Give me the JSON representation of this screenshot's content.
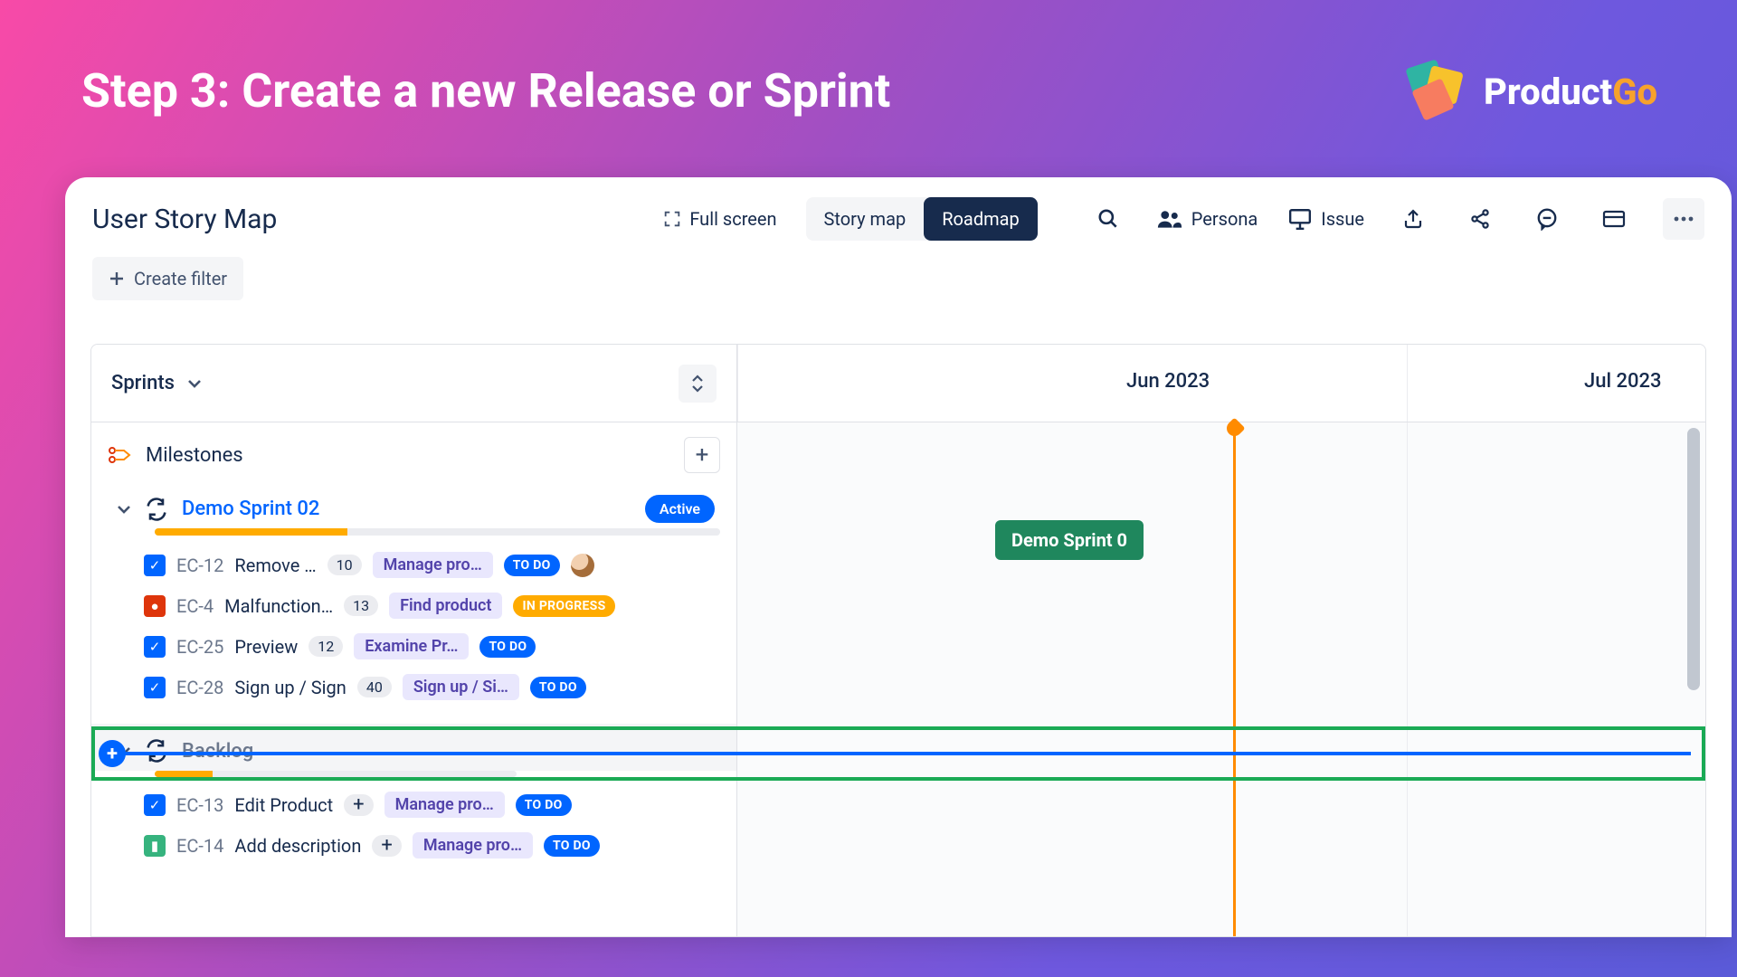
{
  "slide": {
    "title": "Step 3: Create a new Release or Sprint"
  },
  "brand": {
    "name_a": "Product",
    "name_b": "Go"
  },
  "header": {
    "page_title": "User Story Map",
    "fullscreen": "Full screen",
    "tabs": {
      "storymap": "Story map",
      "roadmap": "Roadmap"
    },
    "tools": {
      "persona": "Persona",
      "issue": "Issue"
    }
  },
  "filters": {
    "create": "Create filter"
  },
  "board": {
    "dropdown_label": "Sprints",
    "milestones_label": "Milestones",
    "months": {
      "jun": "Jun 2023",
      "jul": "Jul 2023"
    }
  },
  "sprint1": {
    "name": "Demo Sprint 02",
    "badge": "Active",
    "timeline_label": "Demo Sprint 0",
    "issues": [
      {
        "key": "EC-12",
        "title": "Remove …",
        "count": "10",
        "epic": "Manage pro…",
        "status": "TO DO",
        "type": "task",
        "avatar": true
      },
      {
        "key": "EC-4",
        "title": "Malfunction…",
        "count": "13",
        "epic": "Find product",
        "status": "IN PROGRESS",
        "type": "bug"
      },
      {
        "key": "EC-25",
        "title": "Preview",
        "count": "12",
        "epic": "Examine Pr…",
        "status": "TO DO",
        "type": "task"
      },
      {
        "key": "EC-28",
        "title": "Sign up / Sign",
        "count": "40",
        "epic": "Sign up / Si…",
        "status": "TO DO",
        "type": "task"
      }
    ]
  },
  "backlog": {
    "name": "Backlog",
    "issues": [
      {
        "key": "EC-13",
        "title": "Edit Product",
        "count": "+",
        "epic": "Manage pro…",
        "status": "TO DO",
        "type": "task"
      },
      {
        "key": "EC-14",
        "title": "Add description",
        "count": "+",
        "epic": "Manage pro…",
        "status": "TO DO",
        "type": "story"
      }
    ]
  }
}
